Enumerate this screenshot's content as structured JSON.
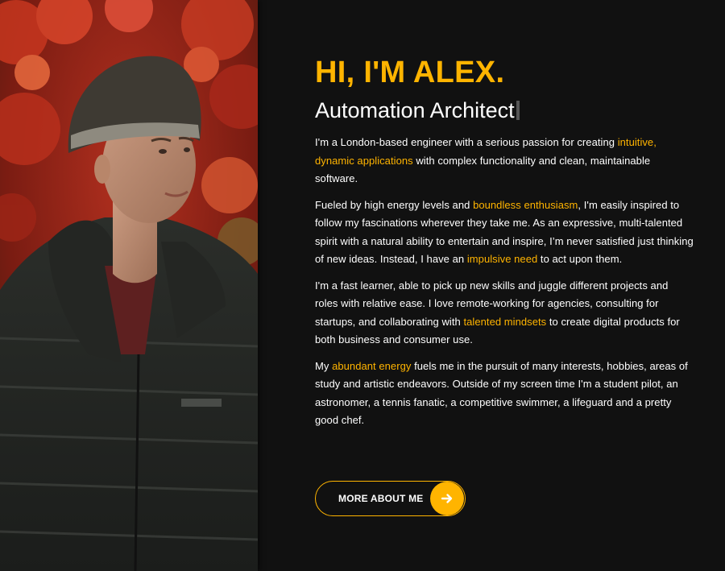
{
  "hero": {
    "heading": "HI, I'M ALEX.",
    "role": "Automation Architect"
  },
  "bio": {
    "p1": {
      "t1": "I'm a London-based engineer with a serious passion for creating ",
      "h1": "intuitive, dynamic applications",
      "t2": " with complex functionality and clean, maintainable software."
    },
    "p2": {
      "t1": "Fueled by high energy levels and ",
      "h1": "boundless enthusiasm",
      "t2": ", I'm easily inspired to follow my fascinations wherever they take me. As an expressive, multi-talented spirit with a natural ability to entertain and inspire, I’m never satisfied just thinking of new ideas. Instead, I have an ",
      "h2": "impulsive need",
      "t3": " to act upon them."
    },
    "p3": {
      "t1": "I'm a fast learner, able to pick up new skills and juggle different projects and roles with relative ease. I love remote-working for agencies, consulting for startups, and collaborating with ",
      "h1": "talented mindsets",
      "t2": " to create digital products for both business and consumer use."
    },
    "p4": {
      "t1": "My ",
      "h1": "abundant energy",
      "t2": " fuels me in the pursuit of many interests, hobbies, areas of study and artistic endeavors. Outside of my screen time I'm a student pilot, an astronomer, a tennis fanatic, a competitive swimmer, a lifeguard and a pretty good chef."
    }
  },
  "cta": {
    "label": "MORE ABOUT ME",
    "icon": "arrow-right-icon"
  },
  "photo": {
    "subject": "portrait-photo"
  },
  "colors": {
    "accent": "#ffb400",
    "background": "#111111",
    "text": "#ffffff"
  }
}
